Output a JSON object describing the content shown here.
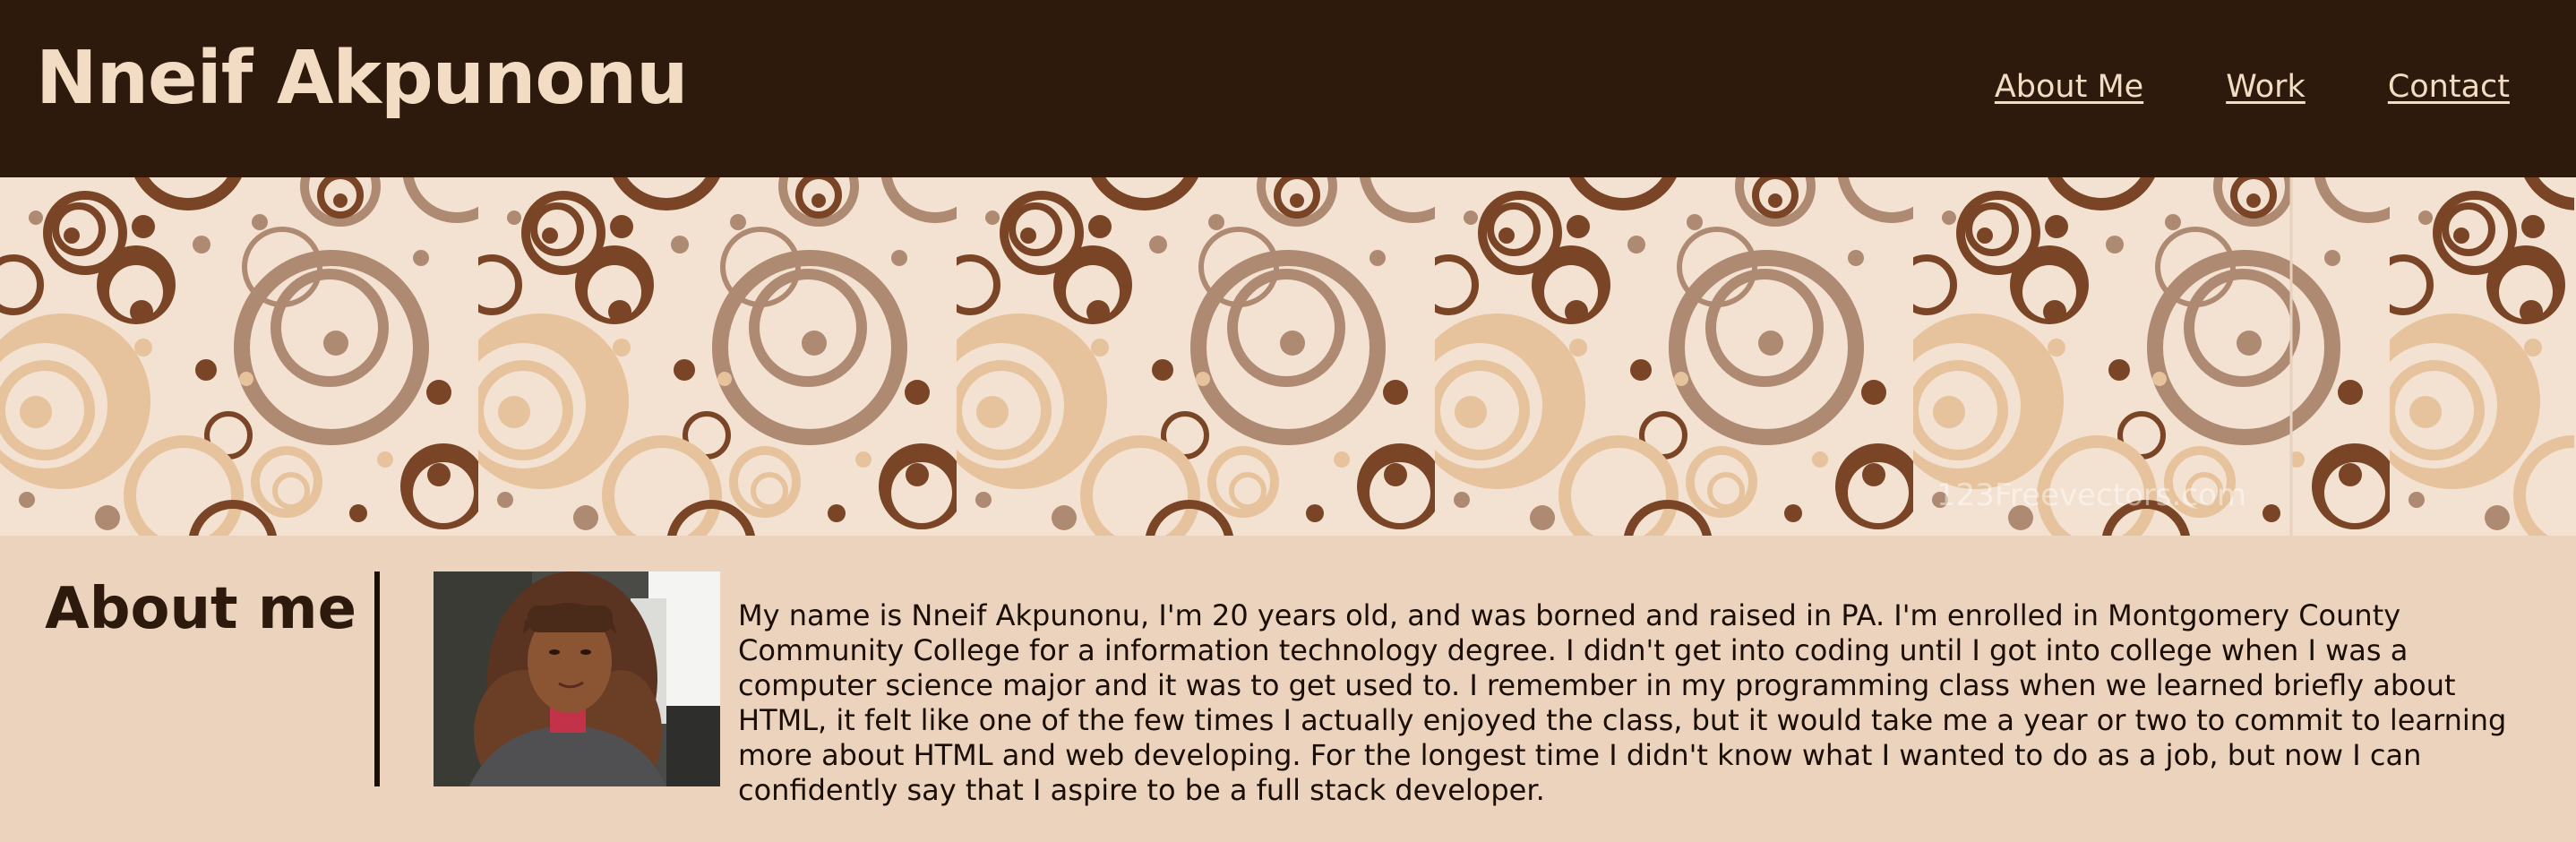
{
  "header": {
    "site_title": "Nneif Akpunonu",
    "nav": [
      {
        "label": "About Me"
      },
      {
        "label": "Work"
      },
      {
        "label": "Contact"
      }
    ]
  },
  "banner": {
    "watermark": "123Freevectors.com",
    "colors": {
      "dark_brown": "#7a4526",
      "taupe": "#ae8a72",
      "tan": "#e6c39d",
      "cream": "#f3e2d1"
    }
  },
  "about": {
    "heading": "About me",
    "photo_alt": "Portrait of Nneif Akpunonu",
    "paragraph": "My name is Nneif Akpunonu, I'm 20 years old, and was borned and raised in PA. I'm enrolled in Montgomery County Community College for a information technology degree. I didn't get into coding until I got into college when I was a computer science major and it was to get used to. I remember in my programming class when we learned briefly about HTML, it felt like one of the few times I actually enjoyed the class, but it would take me a year or two to commit to learning more about HTML and web developing. For the longest time I didn't know what I wanted to do as a job, but now I can confidently say that I aspire to be a full stack developer."
  },
  "theme": {
    "header_bg": "#2d1a0c",
    "title_color": "#f3dcc4",
    "page_bg": "#ecd3bd",
    "text_color": "#1a0e06"
  }
}
